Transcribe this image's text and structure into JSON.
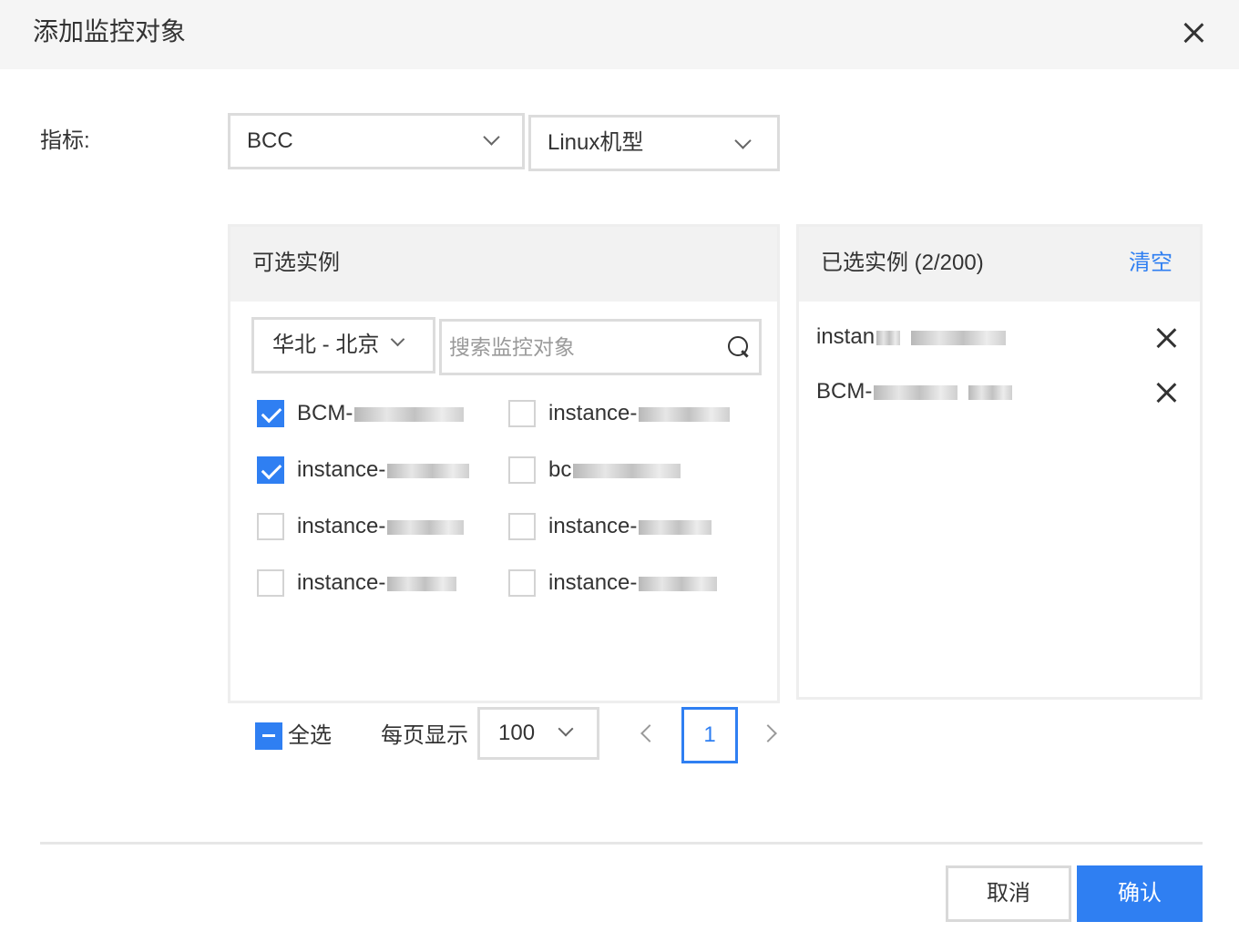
{
  "dialog": {
    "title": "添加监控对象"
  },
  "metric": {
    "label": "指标:",
    "product": "BCC",
    "instance_type": "Linux机型"
  },
  "available": {
    "title": "可选实例",
    "region": "华北 - 北京",
    "search_placeholder": "搜索监控对象",
    "items": [
      {
        "label": "BCM-",
        "checked": true
      },
      {
        "label": "instance-",
        "checked": false
      },
      {
        "label": "instance-",
        "checked": true
      },
      {
        "label": "bc",
        "checked": false
      },
      {
        "label": "instance-",
        "checked": false
      },
      {
        "label": "instance-",
        "checked": false
      },
      {
        "label": "instance-",
        "checked": false
      },
      {
        "label": "instance-",
        "checked": false
      }
    ]
  },
  "selected": {
    "title": "已选实例 (2/200)",
    "clear_label": "清空",
    "items": [
      {
        "label": "instan"
      },
      {
        "label": "BCM-"
      }
    ]
  },
  "footer_controls": {
    "select_all_label": "全选",
    "page_size_label": "每页显示",
    "page_size": "100",
    "current_page": "1"
  },
  "actions": {
    "cancel_label": "取消",
    "confirm_label": "确认"
  },
  "colors": {
    "accent": "#2f7ff2",
    "header_bg": "#f5f5f5",
    "border": "#dcdcdc"
  }
}
